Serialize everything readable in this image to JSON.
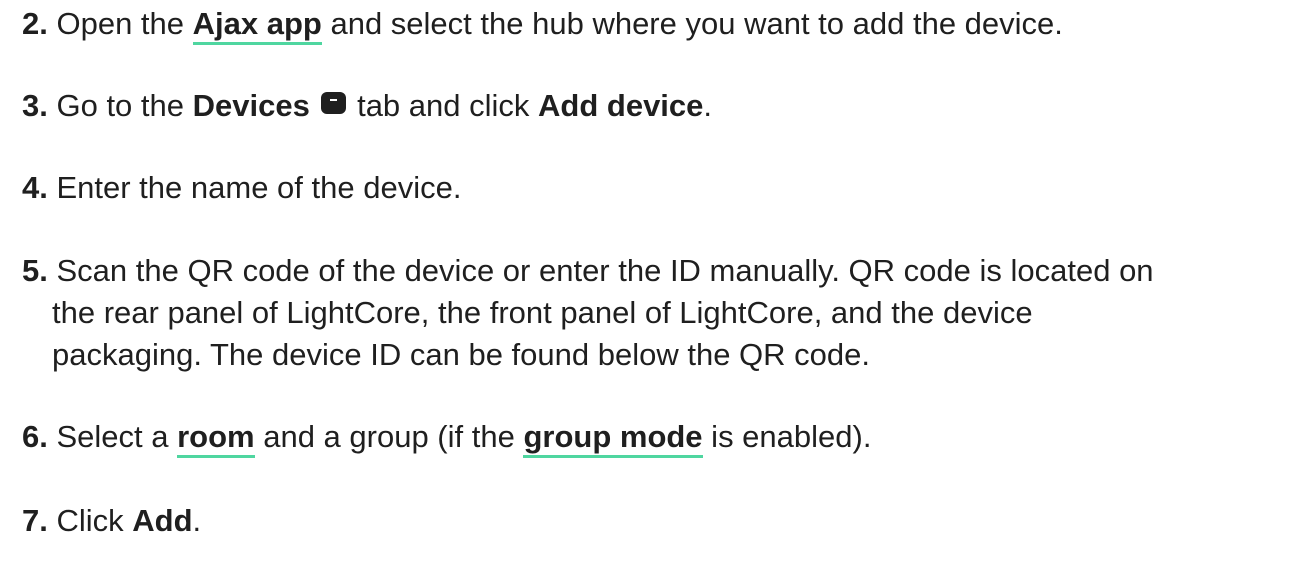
{
  "steps": {
    "s2": {
      "num": "2.",
      "pre": " Open the ",
      "link": "Ajax app",
      "post": " and select the hub where you want to add the device."
    },
    "s3": {
      "num": "3.",
      "pre": " Go to the ",
      "bold1": "Devices",
      "icon": "devices-tab-icon",
      "mid": " tab and click ",
      "bold2": "Add device",
      "post": "."
    },
    "s4": {
      "num": "4.",
      "text": " Enter the name of the device."
    },
    "s5": {
      "num": "5.",
      "line1": " Scan the QR code of the device or enter the ID manually. QR code is located on",
      "line2": "the rear panel of LightCore, the front panel of LightCore, and the device",
      "line3": "packaging. The device ID can be found below the QR code."
    },
    "s6": {
      "num": "6.",
      "pre": " Select a ",
      "link1": "room",
      "mid": " and a group (if the ",
      "link2": "group mode",
      "post": " is enabled)."
    },
    "s7": {
      "num": "7.",
      "pre": " Click ",
      "bold": "Add",
      "post": "."
    }
  },
  "colors": {
    "text": "#1f1f1f",
    "link_underline": "#4fd6a0"
  }
}
